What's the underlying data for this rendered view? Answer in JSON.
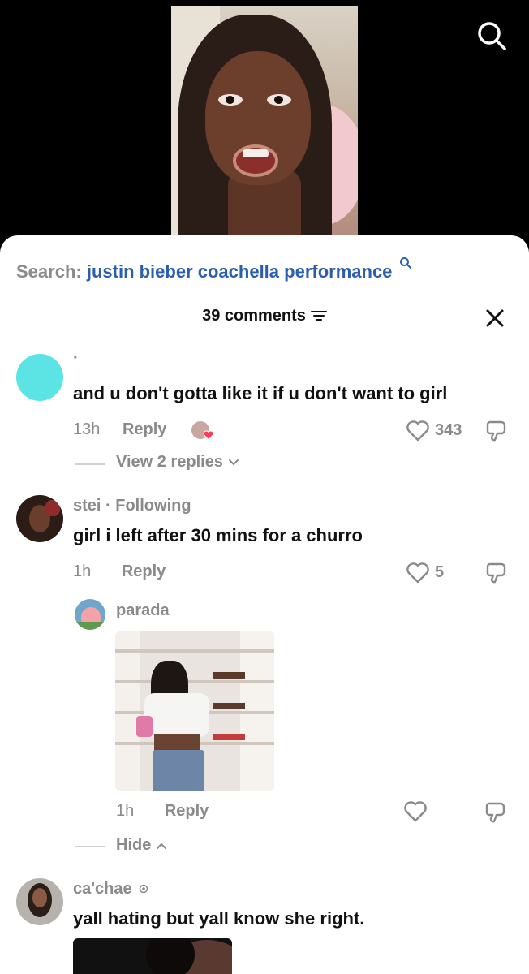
{
  "search": {
    "prefix": "Search:",
    "query": "justin bieber coachella performance"
  },
  "header": {
    "comments_count_label": "39 comments"
  },
  "comments": [
    {
      "username": "·",
      "text": "and u don't gotta like it if u don't want to girl",
      "time": "13h",
      "reply_label": "Reply",
      "likes": "343",
      "view_replies_label": "View 2 replies",
      "avatar_color": "#5ce4e4"
    },
    {
      "username": "stei",
      "following_label": "· Following",
      "text": "girl i left after 30 mins for a churro",
      "time": "1h",
      "reply_label": "Reply",
      "likes": "5"
    },
    {
      "username": "ca'chae",
      "text": "yall hating but yall know she right."
    }
  ],
  "reply": {
    "username": "parada",
    "time": "1h",
    "reply_label": "Reply",
    "hide_label": "Hide"
  },
  "colors": {
    "accent_query": "#2b5fae",
    "muted_text": "#8a8a8a",
    "heart_badge": "#ff3b5c"
  }
}
